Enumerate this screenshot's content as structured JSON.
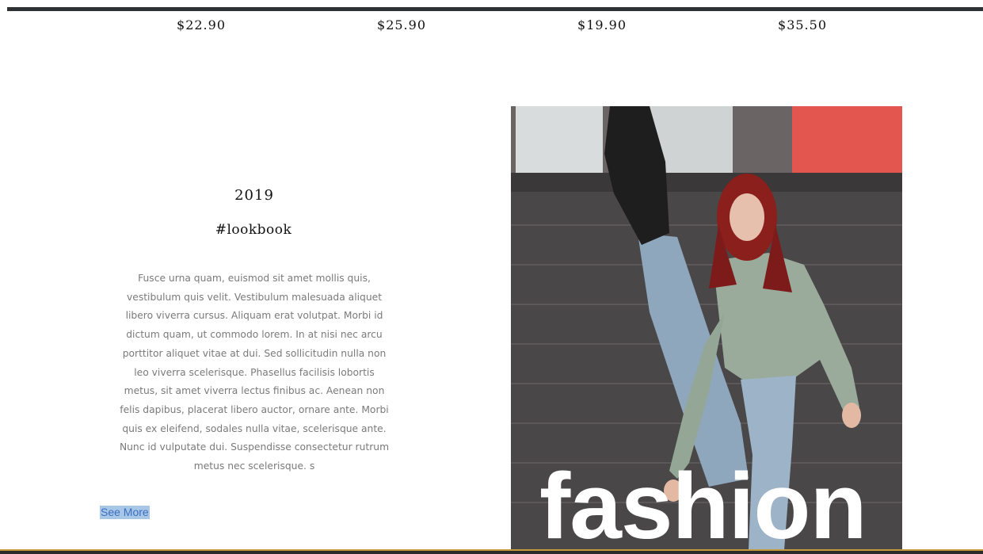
{
  "prices": [
    "$22.90",
    "$25.90",
    "$19.90",
    "$35.50"
  ],
  "lookbook": {
    "year": "2019",
    "hashtag": "#lookbook",
    "description": "Fusce urna quam, euismod sit amet mollis quis, vestibulum quis velit. Vestibulum malesuada aliquet libero viverra cursus. Aliquam erat volutpat. Morbi id dictum quam, ut commodo lorem. In at nisi nec arcu porttitor aliquet vitae at dui. Sed sollicitudin nulla non leo viverra scelerisque. Phasellus facilisis lobortis metus, sit amet viverra lectus finibus ac. Aenean non felis dapibus, placerat libero auctor, ornare ante. Morbi quis ex eleifend, sodales nulla vitae, scelerisque ante. Nunc id vulputate dui. Suspendisse consectetur rutrum metus nec scelerisque. s",
    "see_more_label": "See More"
  },
  "photo": {
    "overlay_text": "fashion"
  },
  "colors": {
    "top_bar": "#2f3235",
    "link_highlight": "#a8c6e6",
    "link_text": "#3b6fc0",
    "bottom_accent": "#c49a3a"
  }
}
